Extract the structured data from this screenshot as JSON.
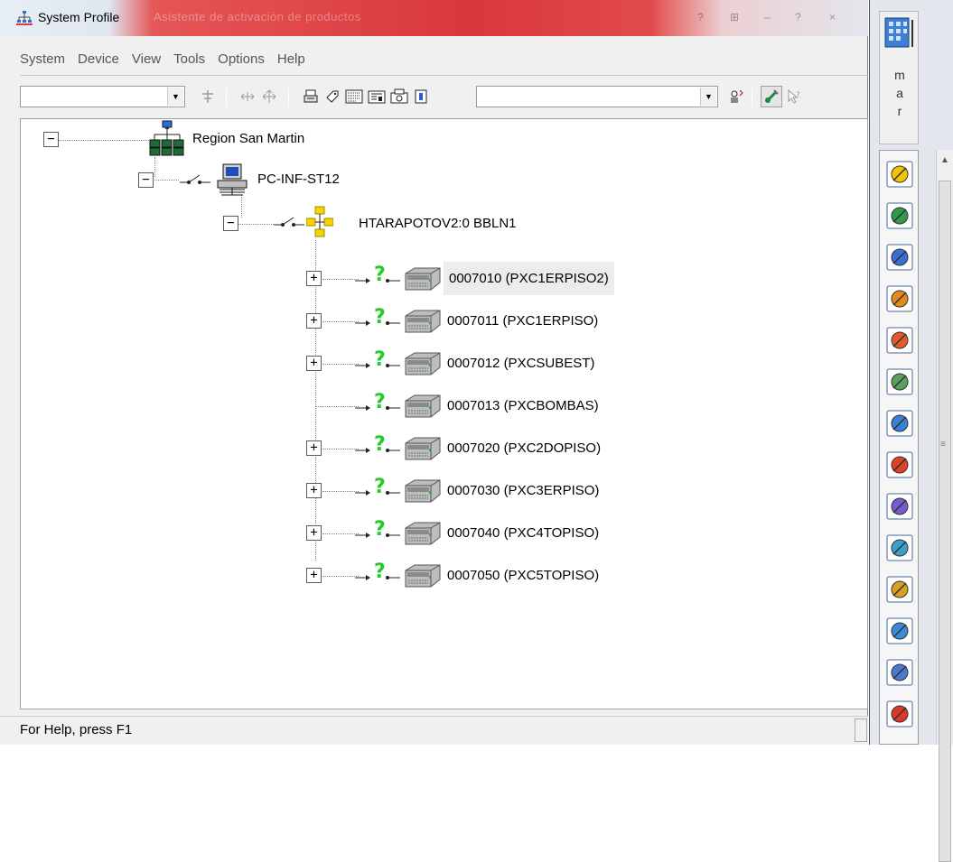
{
  "window": {
    "title": "System Profile",
    "title_ghost": "Asistente de activación de productos",
    "title_buttons": [
      "?",
      "⊞",
      "–",
      "?",
      "×"
    ]
  },
  "menu": [
    "System",
    "Device",
    "View",
    "Tools",
    "Options",
    "Help"
  ],
  "toolbar": {
    "left_combo_value": "",
    "right_combo_value": "",
    "icons": [
      "connect-icon",
      "move-left-right-icon",
      "move-all-icon",
      "print-icon",
      "tag-icon",
      "list-icon",
      "phone-icon",
      "fax-icon",
      "info-icon",
      "search-person-icon",
      "satellite-icon",
      "help-pointer-icon"
    ]
  },
  "tree": {
    "root": "Region San Martin",
    "pc": "PC-INF-ST12",
    "network": "HTARAPOTOV2:0   BBLN1",
    "devices": [
      {
        "label": "0007010 (PXC1ERPISO2)",
        "expandable": true,
        "selected": true
      },
      {
        "label": "0007011 (PXC1ERPISO)",
        "expandable": true,
        "selected": false
      },
      {
        "label": "0007012 (PXCSUBEST)",
        "expandable": true,
        "selected": false
      },
      {
        "label": "0007013 (PXCBOMBAS)",
        "expandable": false,
        "selected": false
      },
      {
        "label": "0007020 (PXC2DOPISO)",
        "expandable": true,
        "selected": false
      },
      {
        "label": "0007030 (PXC3ERPISO)",
        "expandable": true,
        "selected": false
      },
      {
        "label": "0007040 (PXC4TOPISO)",
        "expandable": true,
        "selected": false
      },
      {
        "label": "0007050 (PXC5TOPISO)",
        "expandable": true,
        "selected": false
      }
    ],
    "unknown_glyph": "?"
  },
  "status": {
    "text": "For Help, press F1"
  },
  "sidepanel": {
    "letters": [
      "m",
      "a",
      "r"
    ],
    "buttons": [
      "key-icon",
      "alarm-icon",
      "wrench-icon",
      "schedule-icon",
      "trend-icon",
      "report-search-icon",
      "copy-icon",
      "color-wheel-icon",
      "video-icon",
      "binary-download-icon",
      "building-icon",
      "database-icon",
      "export-icon",
      "warning-icon"
    ]
  },
  "colors": {
    "title_red": "#d9383a",
    "tree_line": "#888888",
    "unknown_green": "#22cc22",
    "selection_bg": "#ececec"
  }
}
